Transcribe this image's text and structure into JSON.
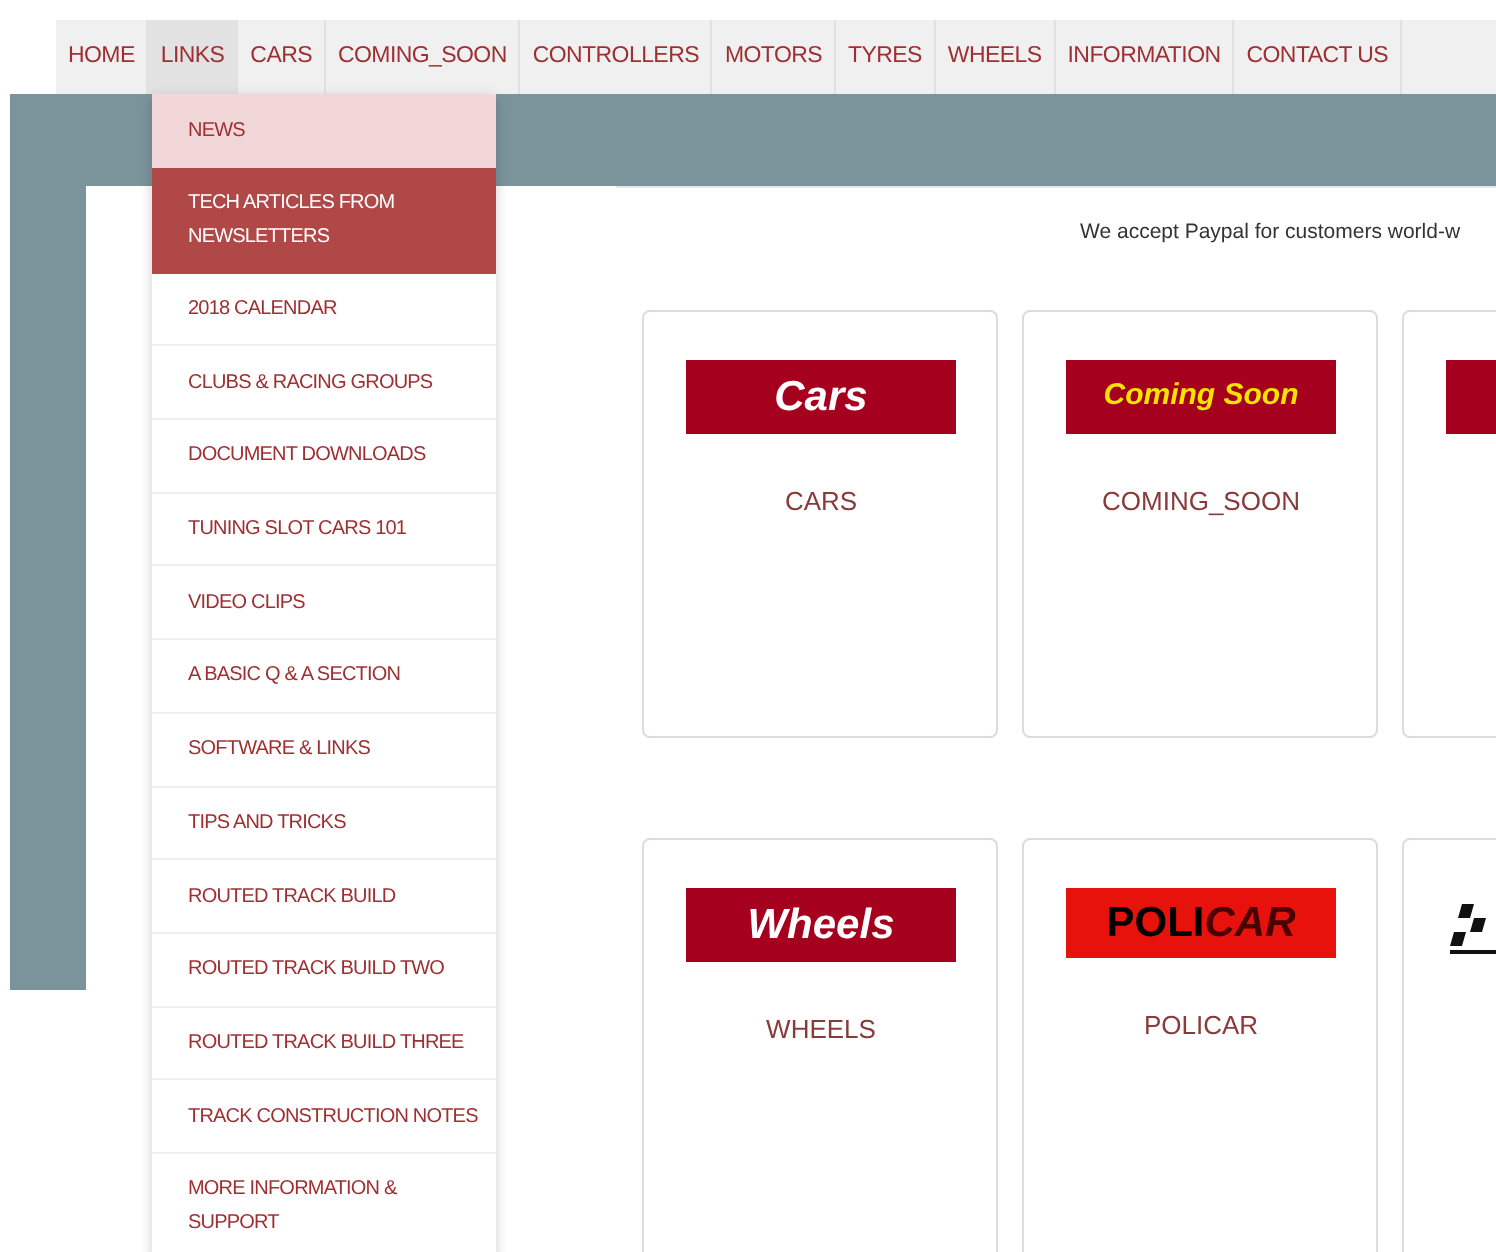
{
  "nav": [
    {
      "label": "HOME",
      "selected": false
    },
    {
      "label": "LINKS",
      "selected": true
    },
    {
      "label": "CARS",
      "selected": false
    },
    {
      "label": "COMING_SOON",
      "selected": false
    },
    {
      "label": "CONTROLLERS",
      "selected": false
    },
    {
      "label": "MOTORS",
      "selected": false
    },
    {
      "label": "TYRES",
      "selected": false
    },
    {
      "label": "WHEELS",
      "selected": false
    },
    {
      "label": "INFORMATION",
      "selected": false
    },
    {
      "label": "CONTACT US",
      "selected": false
    }
  ],
  "dropdown": [
    {
      "label": "NEWS",
      "highlighted": true,
      "selected": false
    },
    {
      "label": "TECH ARTICLES FROM NEWSLETTERS",
      "highlighted": false,
      "selected": true
    },
    {
      "label": "2018 CALENDAR",
      "highlighted": false,
      "selected": false
    },
    {
      "label": "CLUBS & RACING GROUPS",
      "highlighted": false,
      "selected": false
    },
    {
      "label": "DOCUMENT DOWNLOADS",
      "highlighted": false,
      "selected": false
    },
    {
      "label": "TUNING SLOT CARS 101",
      "highlighted": false,
      "selected": false
    },
    {
      "label": "VIDEO CLIPS",
      "highlighted": false,
      "selected": false
    },
    {
      "label": "A BASIC Q & A SECTION",
      "highlighted": false,
      "selected": false
    },
    {
      "label": "SOFTWARE & LINKS",
      "highlighted": false,
      "selected": false
    },
    {
      "label": "TIPS AND TRICKS",
      "highlighted": false,
      "selected": false
    },
    {
      "label": "ROUTED TRACK BUILD",
      "highlighted": false,
      "selected": false
    },
    {
      "label": "ROUTED TRACK BUILD TWO",
      "highlighted": false,
      "selected": false
    },
    {
      "label": "ROUTED TRACK BUILD THREE",
      "highlighted": false,
      "selected": false
    },
    {
      "label": "TRACK CONSTRUCTION NOTES",
      "highlighted": false,
      "selected": false
    },
    {
      "label": "MORE INFORMATION & SUPPORT",
      "highlighted": false,
      "selected": false
    }
  ],
  "notice": "We accept Paypal for customers world-w",
  "cards": [
    {
      "logo": {
        "kind": "white",
        "text": "Cars"
      },
      "label": "CARS"
    },
    {
      "logo": {
        "kind": "yellow",
        "text": "Coming Soon"
      },
      "label": "COMING_SOON"
    },
    {
      "logo": {
        "kind": "plain"
      }
    },
    {
      "logo": {
        "kind": "white",
        "text": "Wheels"
      },
      "label": "WHEELS"
    },
    {
      "logo": {
        "kind": "policar",
        "text": "POLI",
        "text_2": "CAR"
      },
      "label": "POLICAR"
    },
    {
      "logo": {
        "kind": "checker"
      }
    }
  ]
}
